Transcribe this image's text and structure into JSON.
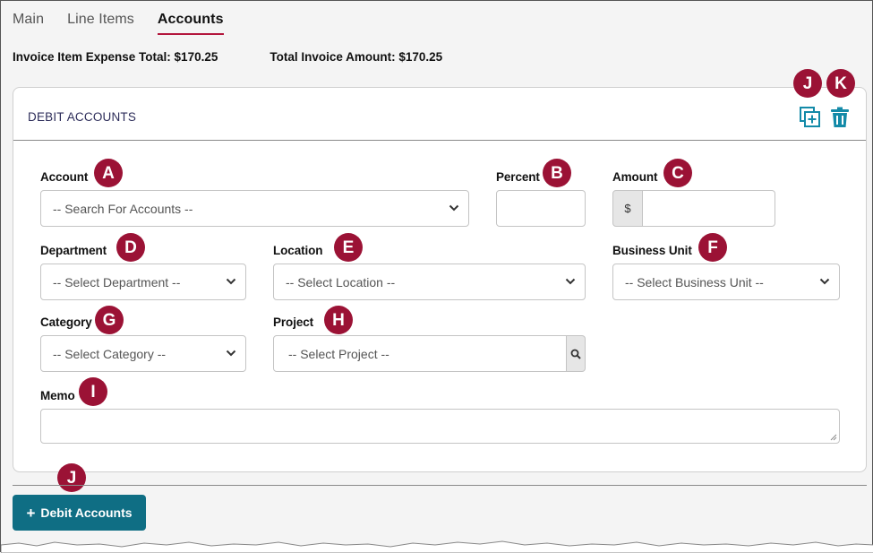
{
  "tabs": [
    {
      "label": "Main",
      "active": false
    },
    {
      "label": "Line Items",
      "active": false
    },
    {
      "label": "Accounts",
      "active": true
    }
  ],
  "totals": {
    "expense_total": "Invoice Item Expense Total: $170.25",
    "invoice_total": "Total Invoice Amount: $170.25"
  },
  "card": {
    "title": "DEBIT ACCOUNTS",
    "copy_icon": "add-copy-icon",
    "trash_icon": "trash-icon"
  },
  "fields": {
    "account": {
      "label": "Account",
      "placeholder": "-- Search For Accounts --"
    },
    "percent": {
      "label": "Percent",
      "value": ""
    },
    "amount": {
      "label": "Amount",
      "prefix": "$",
      "value": ""
    },
    "department": {
      "label": "Department",
      "placeholder": "-- Select Department --"
    },
    "location": {
      "label": "Location",
      "placeholder": "-- Select Location --"
    },
    "business_unit": {
      "label": "Business Unit",
      "placeholder": "-- Select Business Unit --"
    },
    "category": {
      "label": "Category",
      "placeholder": "-- Select Category --"
    },
    "project": {
      "label": "Project",
      "placeholder": "-- Select Project --"
    },
    "memo": {
      "label": "Memo",
      "value": ""
    }
  },
  "badges": {
    "a": "A",
    "b": "B",
    "c": "C",
    "d": "D",
    "e": "E",
    "f": "F",
    "g": "G",
    "h": "H",
    "i": "I",
    "j_top": "J",
    "k": "K",
    "j_bottom": "J"
  },
  "add_button": {
    "icon": "+",
    "label": "Debit Accounts"
  },
  "colors": {
    "accent": "#9b1235",
    "button": "#0f6e84",
    "icon": "#138aa8",
    "tab_underline": "#b3163c"
  }
}
